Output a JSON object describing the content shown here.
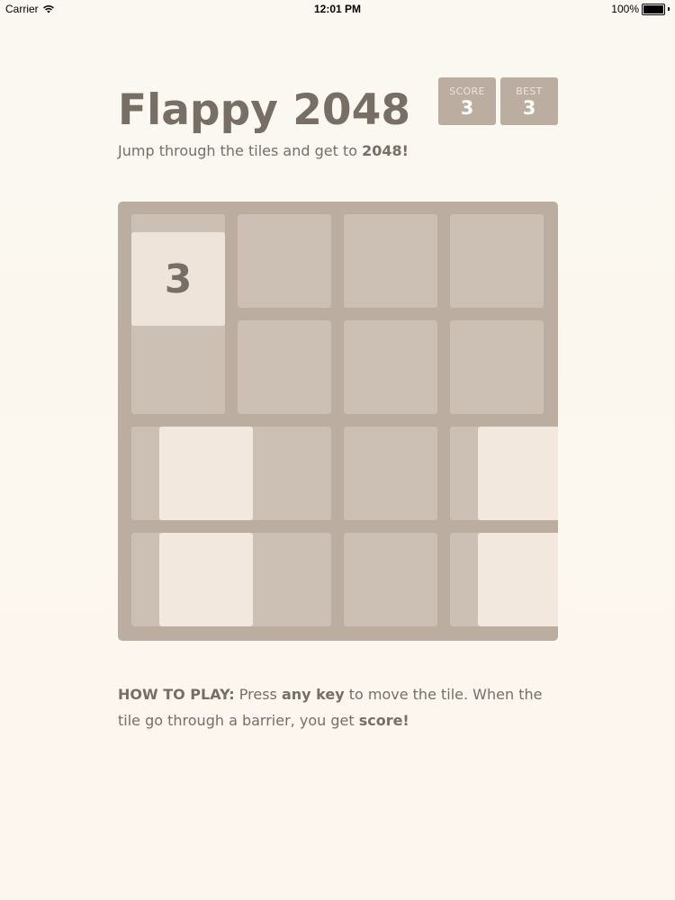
{
  "status_bar": {
    "carrier": "Carrier",
    "time": "12:01 PM",
    "battery": "100%",
    "battery_level": 1.0
  },
  "header": {
    "title": "Flappy 2048",
    "score_label": "SCORE",
    "score_value": "3",
    "best_label": "BEST",
    "best_value": "3",
    "intro_text": "Jump through the tiles and get to ",
    "intro_bold": "2048!"
  },
  "board": {
    "rows": 4,
    "cols": 4,
    "player_tile_value": "3"
  },
  "instructions": {
    "label": "HOW TO PLAY:",
    "text1": " Press ",
    "bold1": "any key",
    "text2": " to move the tile. When the tile go through a barrier, you get ",
    "bold2": "score!"
  },
  "colors": {
    "background": "#faf8f0",
    "board": "#bbada0",
    "text": "#776e65",
    "player_tile": "#eee4da",
    "barrier_tile": "#f3e8de"
  }
}
